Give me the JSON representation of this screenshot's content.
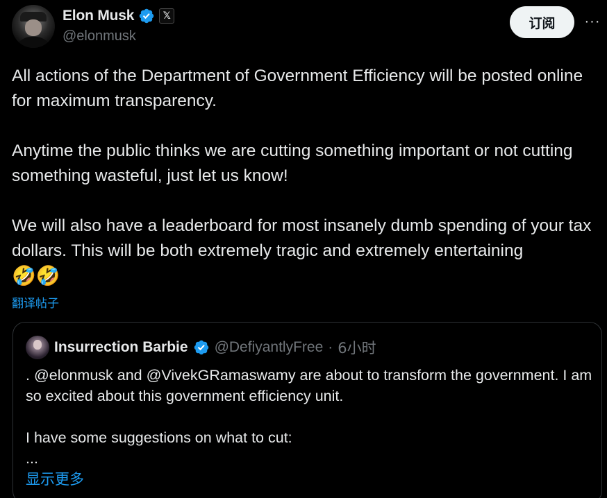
{
  "author": {
    "display_name": "Elon Musk",
    "handle": "@elonmusk",
    "verified_icon": "verified-badge-icon",
    "affiliate_badge": "𝕏"
  },
  "actions": {
    "subscribe_label": "订阅",
    "more_label": "···"
  },
  "tweet": {
    "paragraphs": [
      "All actions of the Department of Government Efficiency will be posted online for maximum transparency.",
      "Anytime the public thinks we are cutting something important or not cutting something wasteful, just let us know!",
      "We will also have a leaderboard for most insanely dumb spending of your tax dollars. This will be both extremely tragic and extremely entertaining"
    ],
    "emojis": "🤣🤣",
    "translate_label": "翻译帖子"
  },
  "quote": {
    "display_name": "Insurrection Barbie",
    "handle": "@DefiyantlyFree",
    "separator": "·",
    "time": "6小时",
    "paragraphs": [
      ". @elonmusk and @VivekGRamaswamy are about to transform the government. I am so excited about this government efficiency unit.",
      "I have some suggestions on what to cut:\n..."
    ],
    "show_more_label": "显示更多"
  },
  "colors": {
    "background": "#000000",
    "text": "#e7e9ea",
    "muted": "#71767b",
    "accent": "#1d9bf0",
    "border": "#2f3336"
  }
}
